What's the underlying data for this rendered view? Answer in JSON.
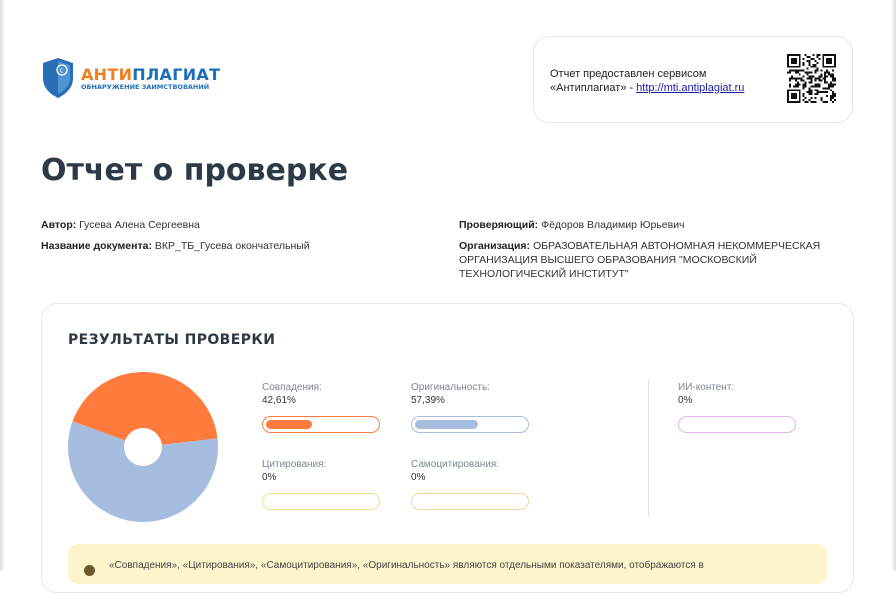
{
  "logo": {
    "text_part1": "АНТИ",
    "text_part2": "ПЛАГИАТ",
    "subtitle": "ОБНАРУЖЕНИЕ ЗАИМСТВОВАНИЙ",
    "colors": {
      "orange": "#f07f22",
      "blue": "#1f6fb8"
    }
  },
  "service": {
    "line1": "Отчет предоставлен сервисом",
    "line2_prefix": "«Антиплагиат» - ",
    "link": "http://mti.antiplagiat.ru"
  },
  "title": "Отчет о проверке",
  "meta": {
    "author_label": "Автор:",
    "author_value": "Гусева Алена Сергеевна",
    "doc_label": "Название документа:",
    "doc_value": "ВКР_ТБ_Гусева окончательный",
    "reviewer_label": "Проверяющий:",
    "reviewer_value": "Фёдоров Владимир Юрьевич",
    "org_label": "Организация:",
    "org_line1": "ОБРАЗОВАТЕЛЬНАЯ АВТОНОМНАЯ НЕКОММЕРЧЕСКАЯ",
    "org_line2": "ОРГАНИЗАЦИЯ ВЫСШЕГО ОБРАЗОВАНИЯ \"МОСКОВСКИЙ",
    "org_line3": "ТЕХНОЛОГИЧЕСКИЙ ИНСТИТУТ\""
  },
  "results": {
    "heading": "РЕЗУЛЬТАТЫ ПРОВЕРКИ",
    "metrics": {
      "matches": {
        "label": "Совпадения:",
        "value": "42,61%",
        "fraction": 0.4261,
        "color": "#ff7a3d"
      },
      "originality": {
        "label": "Оригинальность:",
        "value": "57,39%",
        "fraction": 0.5739,
        "color": "#a6bde0"
      },
      "citations": {
        "label": "Цитирования:",
        "value": "0%",
        "fraction": 0,
        "color": "#f3dc8a"
      },
      "selfcitations": {
        "label": "Самоцитирования:",
        "value": "0%",
        "fraction": 0,
        "color": "#f6d49a"
      },
      "ai": {
        "label": "ИИ-контент:",
        "value": "0%",
        "fraction": 0,
        "color": "#e6b3ec"
      }
    }
  },
  "chart_data": {
    "type": "pie",
    "categories": [
      "Совпадения",
      "Оригинальность",
      "Цитирования",
      "Самоцитирования"
    ],
    "values": [
      42.61,
      57.39,
      0,
      0
    ],
    "colors": [
      "#ff7a3d",
      "#a6bde0",
      "#f3dc8a",
      "#f6d49a"
    ]
  },
  "note": {
    "text": "«Совпадения», «Цитирования», «Самоцитирования», «Оригинальность» являются отдельными показателями, отображаются в"
  }
}
